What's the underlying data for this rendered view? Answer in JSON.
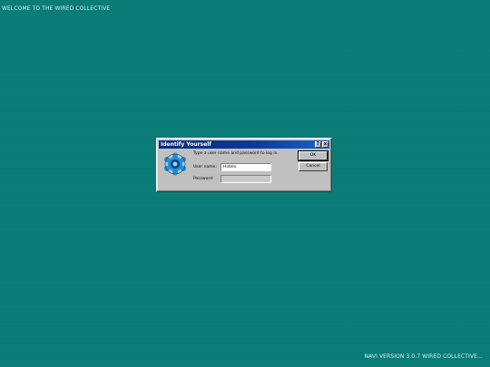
{
  "desktop": {
    "welcome_text": "WELCOME TO THE WIRED COLLECTIVE",
    "version_text": "NAVI VERSION 3.0.7 WIRED COLLECTIVE...",
    "background_color": "#0a7f7a"
  },
  "dialog": {
    "title": "Identify Yourself",
    "help_button": "?",
    "close_button": "x",
    "icon": "wired-logo-icon",
    "prompt": "Type a user name and password to log in.",
    "username_label": "User name:",
    "username_value": "Hidelo",
    "password_label": "Password:",
    "password_value": "",
    "ok_label": "OK",
    "cancel_label": "Cancel",
    "titlebar_color": "#0b3a9a"
  }
}
